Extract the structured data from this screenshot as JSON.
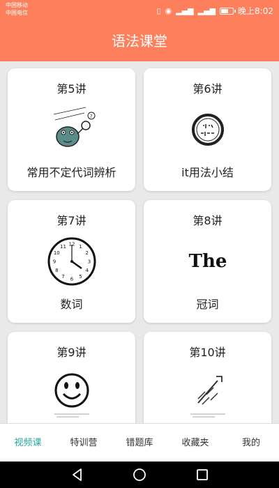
{
  "status_bar": {
    "carrier_1": "中国移动",
    "carrier_2": "中国电信",
    "time": "晚上8:02",
    "battery_level": 0.65
  },
  "header": {
    "title": "语法课堂"
  },
  "cards": [
    {
      "lecture": "第5讲",
      "title": "常用不定代词辨析",
      "image": "looking-for-something-illustration"
    },
    {
      "lecture": "第6讲",
      "title": "it用法小结",
      "image": "its-free-stamp"
    },
    {
      "lecture": "第7讲",
      "title": "数词",
      "image": "clock-illustration"
    },
    {
      "lecture": "第8讲",
      "title": "冠词",
      "image": "the-word-art",
      "image_text": "The"
    },
    {
      "lecture": "第9讲",
      "title": "",
      "image": "smiley-face-illustration"
    },
    {
      "lecture": "第10讲",
      "title": "",
      "image": "broken-chain-illustration"
    }
  ],
  "bottom_nav": {
    "items": [
      {
        "label": "视频课",
        "active": true
      },
      {
        "label": "特训营",
        "active": false
      },
      {
        "label": "错题库",
        "active": false
      },
      {
        "label": "收藏夹",
        "active": false
      },
      {
        "label": "我的",
        "active": false
      }
    ]
  },
  "colors": {
    "header_bg": "#fd7f5c",
    "active_tab": "#26a69a",
    "page_bg": "#e9e9e9"
  }
}
